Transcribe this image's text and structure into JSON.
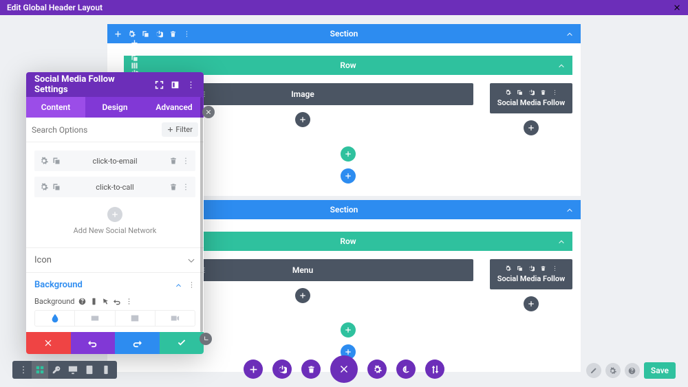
{
  "header": {
    "title": "Edit Global Header Layout"
  },
  "canvas": {
    "sections": [
      {
        "label": "Section",
        "row": {
          "label": "Row",
          "modules": [
            {
              "label": "Image"
            },
            {
              "label": "Social Media Follow"
            }
          ]
        }
      },
      {
        "label": "Section",
        "row": {
          "label": "Row",
          "modules": [
            {
              "label": "Menu"
            },
            {
              "label": "Social Media Follow"
            }
          ]
        }
      }
    ]
  },
  "panel": {
    "title": "Social Media Follow Settings",
    "tabs": [
      "Content",
      "Design",
      "Advanced"
    ],
    "search_placeholder": "Search Options",
    "filter_label": "Filter",
    "items": [
      {
        "label": "click-to-email"
      },
      {
        "label": "click-to-call"
      }
    ],
    "add_label": "Add New Social Network",
    "accordions": {
      "icon": "Icon",
      "background": "Background"
    },
    "bg_label": "Background"
  },
  "bottom": {
    "save": "Save"
  }
}
